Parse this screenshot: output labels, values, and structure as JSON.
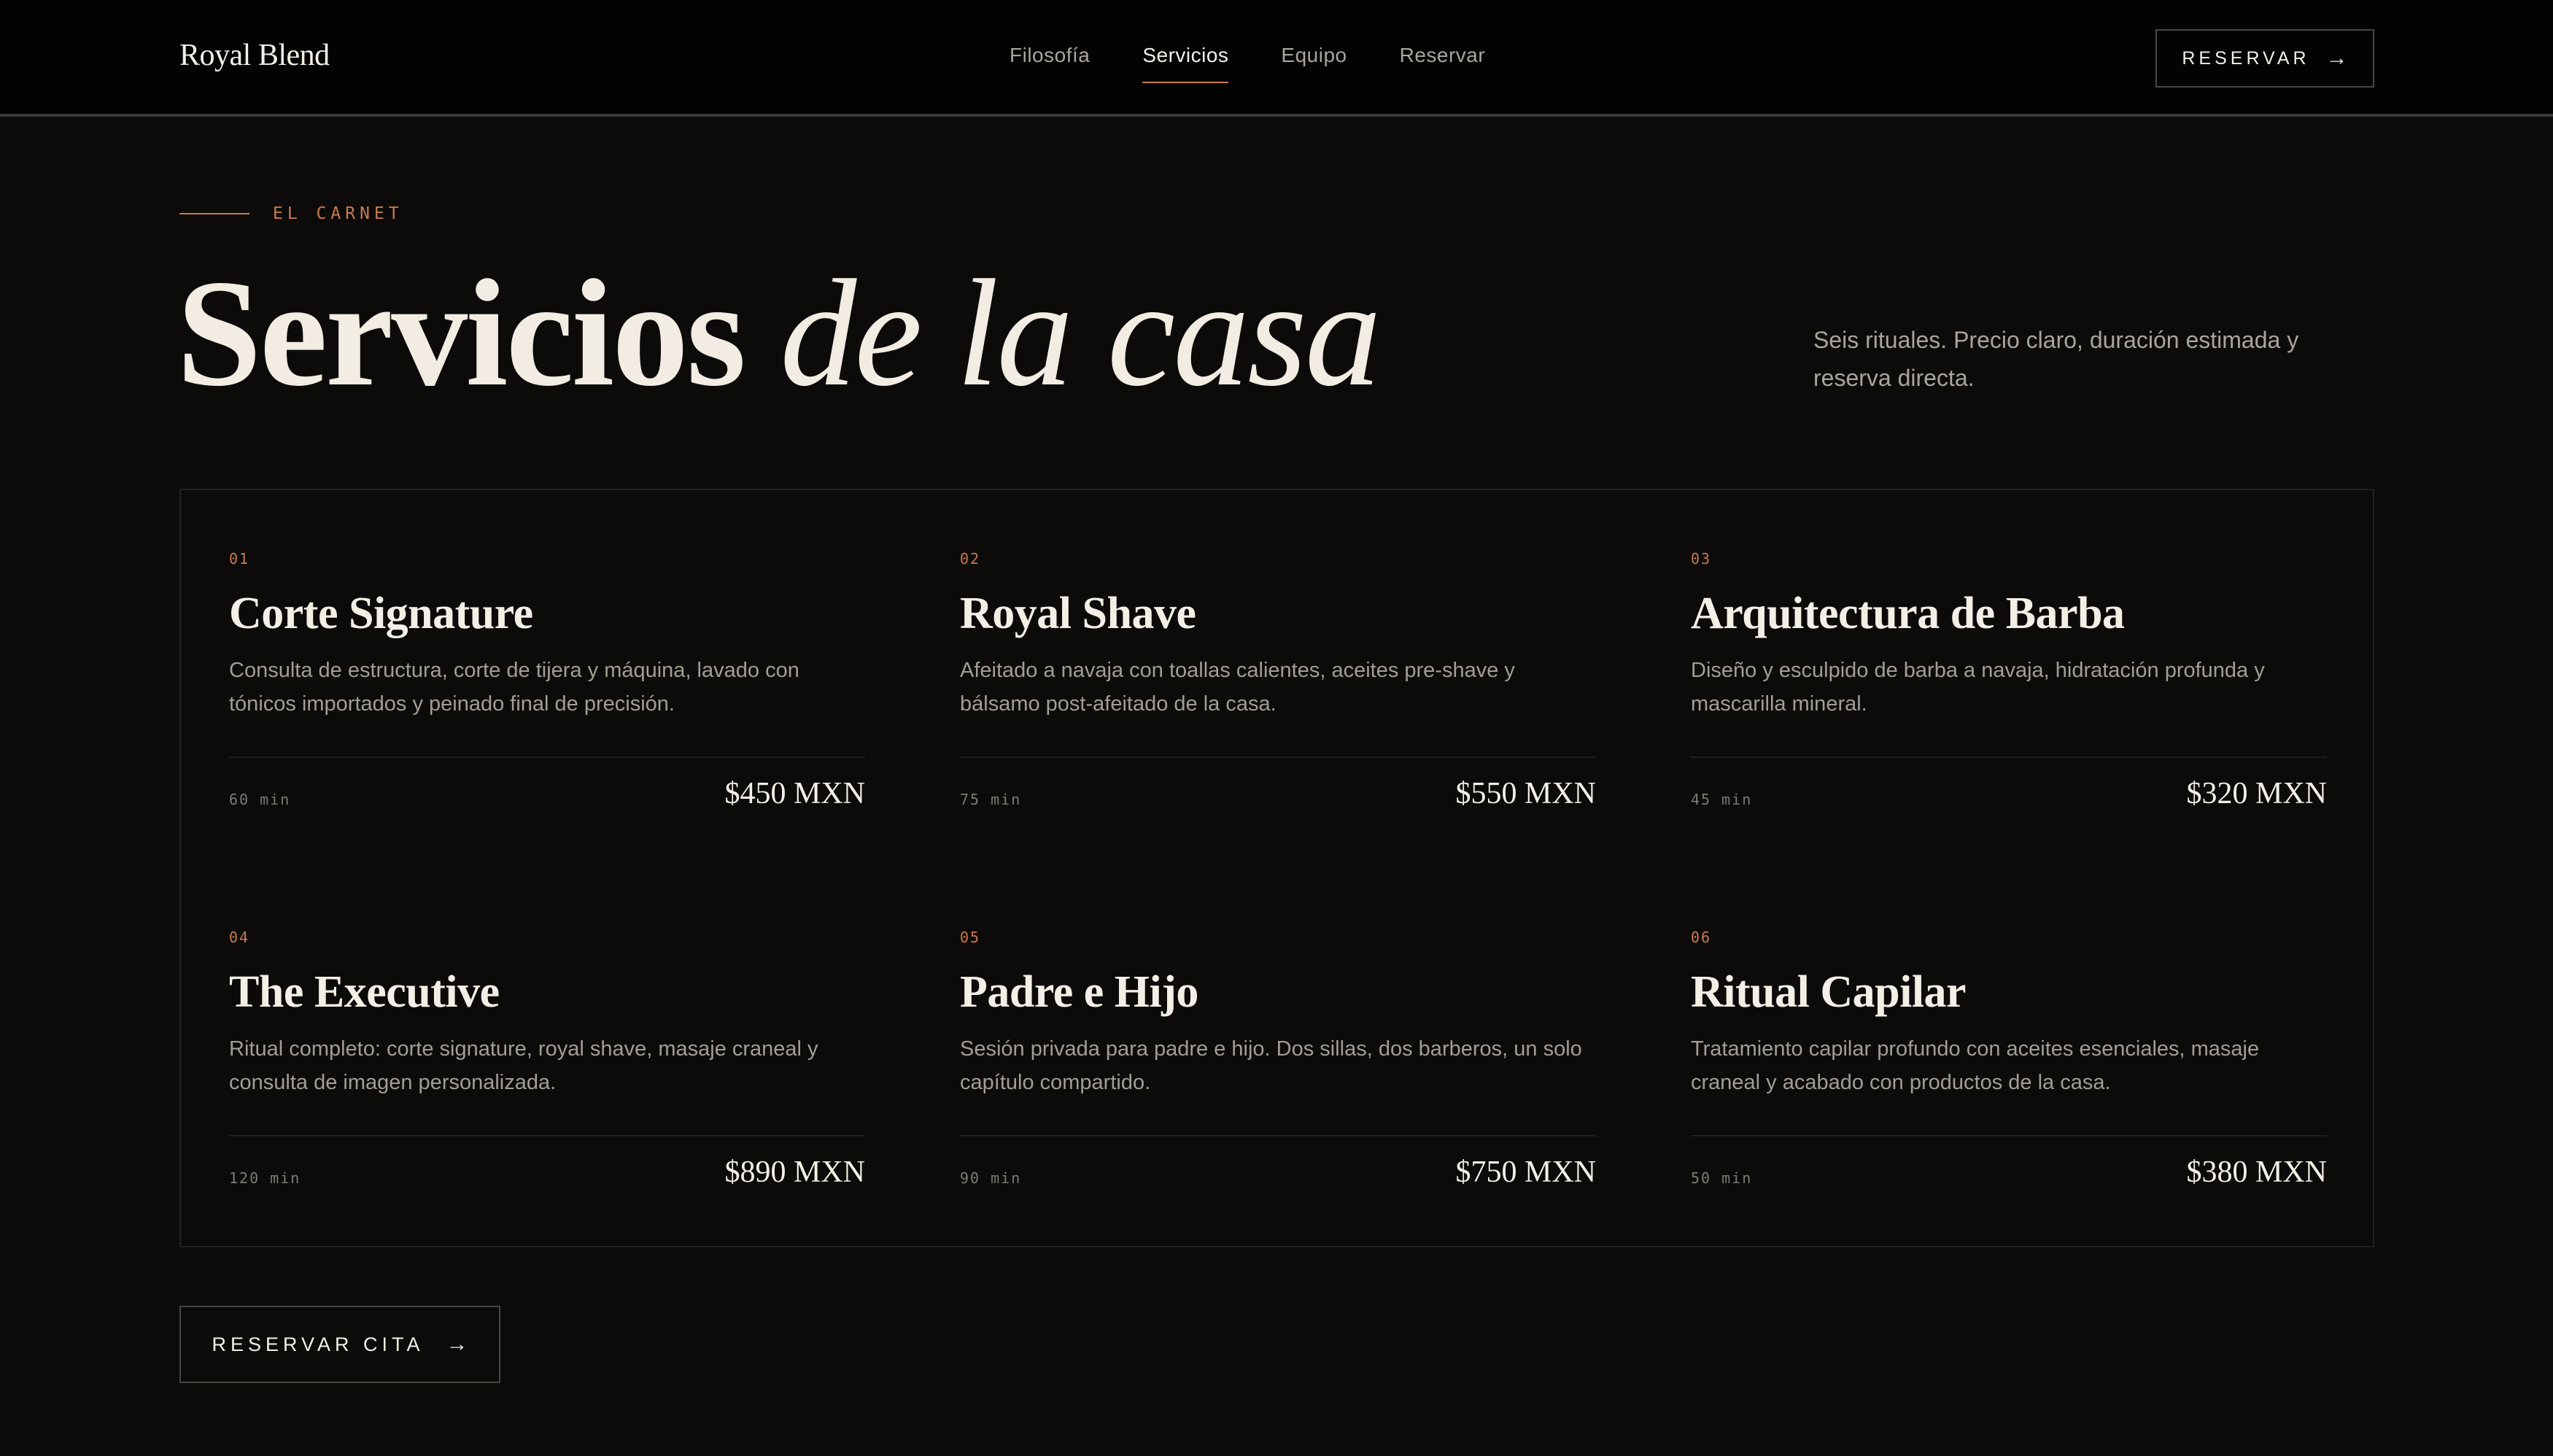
{
  "header": {
    "brand": "Royal Blend",
    "nav": [
      "Filosofía",
      "Servicios",
      "Equipo",
      "Reservar"
    ],
    "active_nav": "Servicios",
    "cta_label": "RESERVAR",
    "cta_arrow": "→"
  },
  "hero": {
    "eyebrow": "EL CARNET",
    "title_plain": "Servicios",
    "title_italic": "de la casa",
    "description": "Seis rituales. Precio claro, duración estimada y reserva directa."
  },
  "services": [
    {
      "num": "01",
      "title": "Corte Signature",
      "desc": "Consulta de estructura, corte de tijera y máquina, lavado con tónicos importados y peinado final de precisión.",
      "duration": "60 min",
      "price": "$450 MXN"
    },
    {
      "num": "02",
      "title": "Royal Shave",
      "desc": "Afeitado a navaja con toallas calientes, aceites pre-shave y bálsamo post-afeitado de la casa.",
      "duration": "75 min",
      "price": "$550 MXN"
    },
    {
      "num": "03",
      "title": "Arquitectura de Barba",
      "desc": "Diseño y esculpido de barba a navaja, hidratación profunda y mascarilla mineral.",
      "duration": "45 min",
      "price": "$320 MXN"
    },
    {
      "num": "04",
      "title": "The Executive",
      "desc": "Ritual completo: corte signature, royal shave, masaje craneal y consulta de imagen personalizada.",
      "duration": "120 min",
      "price": "$890 MXN"
    },
    {
      "num": "05",
      "title": "Padre e Hijo",
      "desc": "Sesión privada para padre e hijo. Dos sillas, dos barberos, un solo capítulo compartido.",
      "duration": "90 min",
      "price": "$750 MXN"
    },
    {
      "num": "06",
      "title": "Ritual Capilar",
      "desc": "Tratamiento capilar profundo con aceites esenciales, masaje craneal y acabado con productos de la casa.",
      "duration": "50 min",
      "price": "$380 MXN"
    }
  ],
  "bottom_cta": {
    "label": "RESERVAR CITA",
    "arrow": "→"
  },
  "colors": {
    "background": "#0c0b0a",
    "header": "#030303",
    "accent": "#c97a52",
    "text": "#f2ece2",
    "muted": "#aaa49b"
  }
}
